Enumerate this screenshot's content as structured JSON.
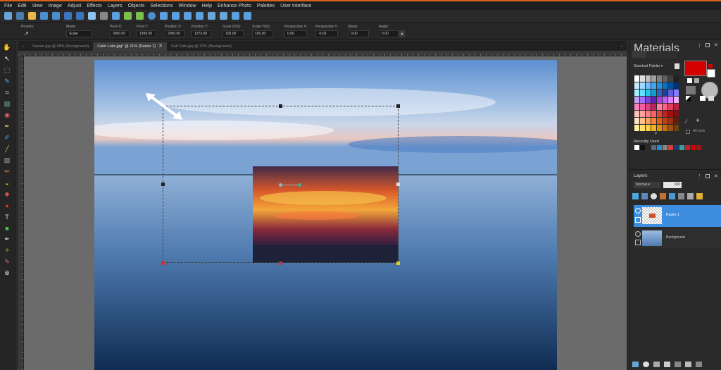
{
  "menu": [
    "File",
    "Edit",
    "View",
    "Image",
    "Adjust",
    "Effects",
    "Layers",
    "Objects",
    "Selections",
    "Window",
    "Help",
    "Enhance Photo",
    "Palettes",
    "User Interface"
  ],
  "options": {
    "presets_label": "Presets:",
    "mode_label": "Mode:",
    "mode_value": "Scale",
    "pivot_x_label": "Pivot X:",
    "pivot_x": "3000.00",
    "pivot_y_label": "Pivot Y:",
    "pivot_y": "1999.50",
    "position_x_label": "Position X:",
    "position_x": "2060.00",
    "position_y_label": "Position Y:",
    "position_y": "1373.00",
    "scale_x_label": "Scale X(%):",
    "scale_x": "100.00",
    "scale_y_label": "Scale Y(%):",
    "scale_y": "100.00",
    "persp_x_label": "Perspective X:",
    "persp_x": "0.00",
    "persp_y_label": "Perspective Y:",
    "persp_y": "-0.00",
    "shear_label": "Shear:",
    "shear": "0.00",
    "angle_label": "Angle:",
    "angle": "0.00"
  },
  "tabs": [
    {
      "label": "Sunset.jpg @  65% (Background)",
      "active": false
    },
    {
      "label": "Calm Lake.jpg* @  21% (Raster 1)",
      "active": true
    },
    {
      "label": "Salt Flats.jpg @  32% (Background)",
      "active": false
    }
  ],
  "materials": {
    "title": "Materials",
    "palette_select": "Standard Palette",
    "all_tools_label": "All tools",
    "recently_used_label": "Recently Used",
    "foreground_color": "#d40000"
  },
  "layers": {
    "title": "Layers",
    "blend_mode": "Normal",
    "opacity": "100",
    "items": [
      {
        "name": "Raster 1",
        "selected": true
      },
      {
        "name": "Background",
        "selected": false
      }
    ]
  },
  "colors": {
    "accent": "#d9611c",
    "selection": "#3d8ee0"
  }
}
